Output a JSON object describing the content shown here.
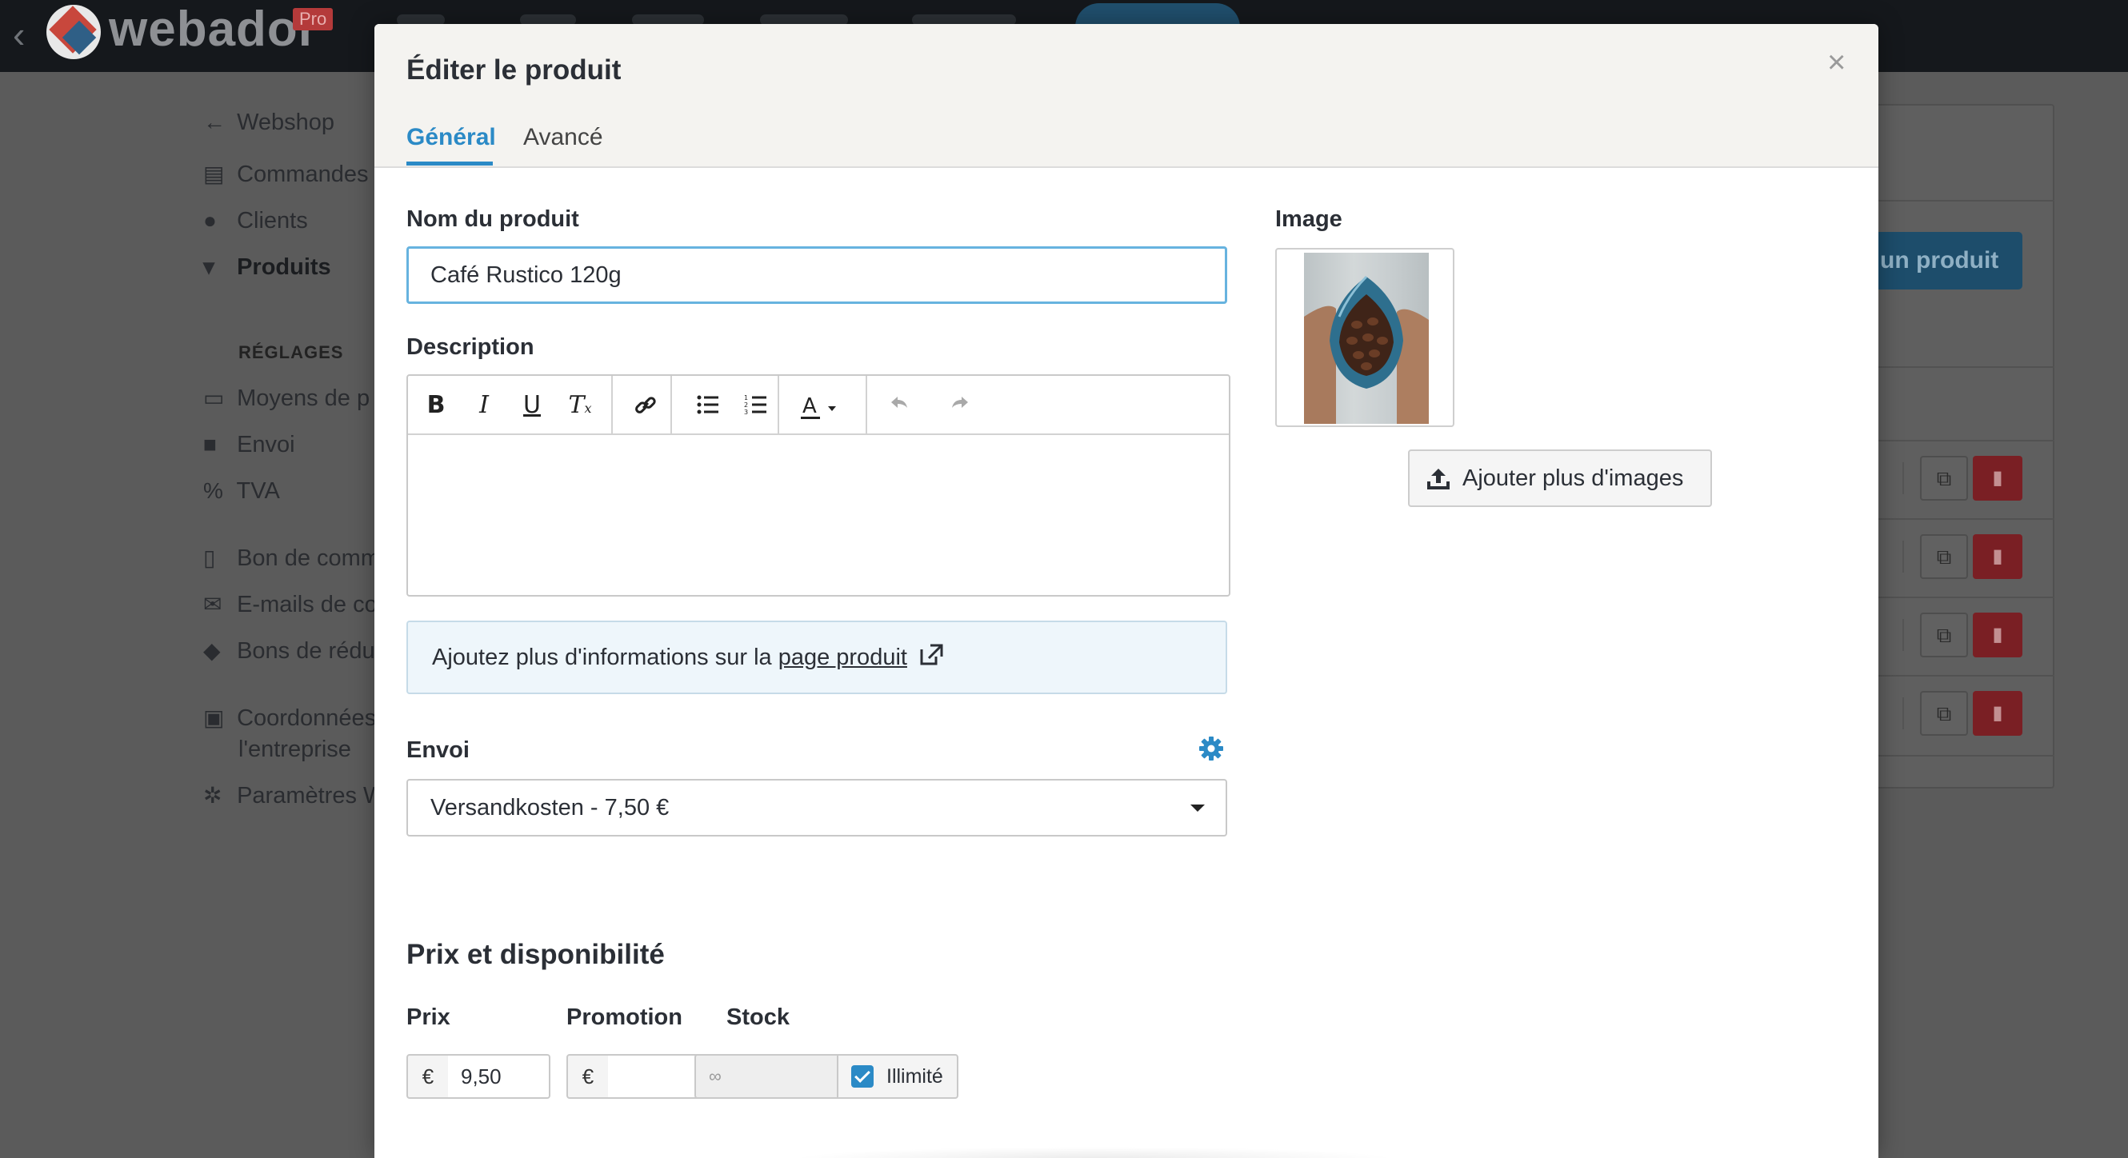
{
  "app": {
    "logo_text": "webador",
    "badge": "Pro",
    "add_product_button": "r un produit"
  },
  "sidebar": {
    "back_label": "Webshop",
    "items": [
      {
        "label": "Commandes",
        "icon": "orders-icon"
      },
      {
        "label": "Clients",
        "icon": "user-icon"
      },
      {
        "label": "Produits",
        "icon": "cart-icon",
        "active": true
      }
    ],
    "settings_heading": "RÉGLAGES",
    "settings_items": [
      {
        "label": "Moyens de p",
        "icon": "credit-card-icon"
      },
      {
        "label": "Envoi",
        "icon": "truck-icon"
      },
      {
        "label": "TVA",
        "icon": "percent-icon"
      },
      {
        "label": "Bon de comm",
        "icon": "document-icon"
      },
      {
        "label": "E-mails de co",
        "icon": "envelope-icon"
      },
      {
        "label": "Bons de rédu",
        "icon": "tag-icon"
      },
      {
        "label": "Coordonnées",
        "label2": "l'entreprise",
        "icon": "id-card-icon"
      },
      {
        "label": "Paramètres W",
        "icon": "gear-icon"
      }
    ]
  },
  "modal": {
    "title": "Éditer le produit",
    "close_symbol": "×",
    "tabs": [
      {
        "label": "Général",
        "active": true
      },
      {
        "label": "Avancé",
        "active": false
      }
    ],
    "product_name_label": "Nom du produit",
    "product_name_value": "Café Rustico 120g",
    "description_label": "Description",
    "description_toolbar": [
      "bold-icon",
      "italic-icon",
      "underline-icon",
      "clear-format-icon",
      "link-icon",
      "bullet-list-icon",
      "numbered-list-icon",
      "text-color-icon",
      "undo-icon",
      "redo-icon"
    ],
    "info_text": "Ajoutez plus d'informations sur la ",
    "info_link": "page produit",
    "shipping_label": "Envoi",
    "shipping_value": "Versandkosten - 7,50 €",
    "image_label": "Image",
    "add_images_button": "Ajouter plus d'images",
    "pricing_title": "Prix et disponibilité",
    "price_label": "Prix",
    "promotion_label": "Promotion",
    "stock_label": "Stock",
    "currency_symbol": "€",
    "price_value": "9,50",
    "promotion_value": "",
    "stock_value": "∞",
    "unlimited_label": "Illimité",
    "unlimited_checked": true
  },
  "colors": {
    "accent": "#2b8ac6",
    "topbar": "#15181c",
    "delete": "#7a1f24"
  }
}
